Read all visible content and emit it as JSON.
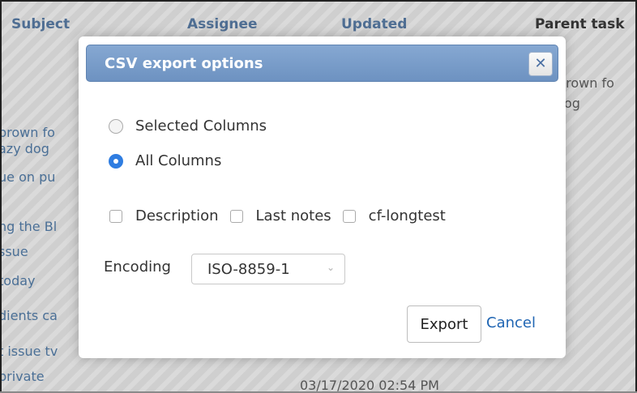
{
  "background": {
    "columns": [
      "Subject",
      "Assignee",
      "Updated",
      "Parent task"
    ],
    "left_fragments": [
      "brown fo",
      "azy dog",
      "ue on pu",
      "ng the Bl",
      "ssue",
      "today",
      "dients ca",
      "t issue tv",
      "private"
    ],
    "right_fragments": [
      "brown fo",
      "og"
    ],
    "bottom_date": "03/17/2020 02:54 PM"
  },
  "dialog": {
    "title": "CSV export options",
    "close_icon": "close-icon",
    "radios": [
      {
        "label": "Selected Columns",
        "checked": false
      },
      {
        "label": "All Columns",
        "checked": true
      }
    ],
    "checkboxes": [
      {
        "label": "Description",
        "checked": false
      },
      {
        "label": "Last notes",
        "checked": false
      },
      {
        "label": "cf-longtest",
        "checked": false
      }
    ],
    "encoding": {
      "label": "Encoding",
      "value": "ISO-8859-1"
    },
    "export_label": "Export",
    "cancel_label": "Cancel"
  },
  "colors": {
    "accent": "#2f7de1",
    "title_bar": "#7a9ccb",
    "link": "#1f65b3"
  }
}
